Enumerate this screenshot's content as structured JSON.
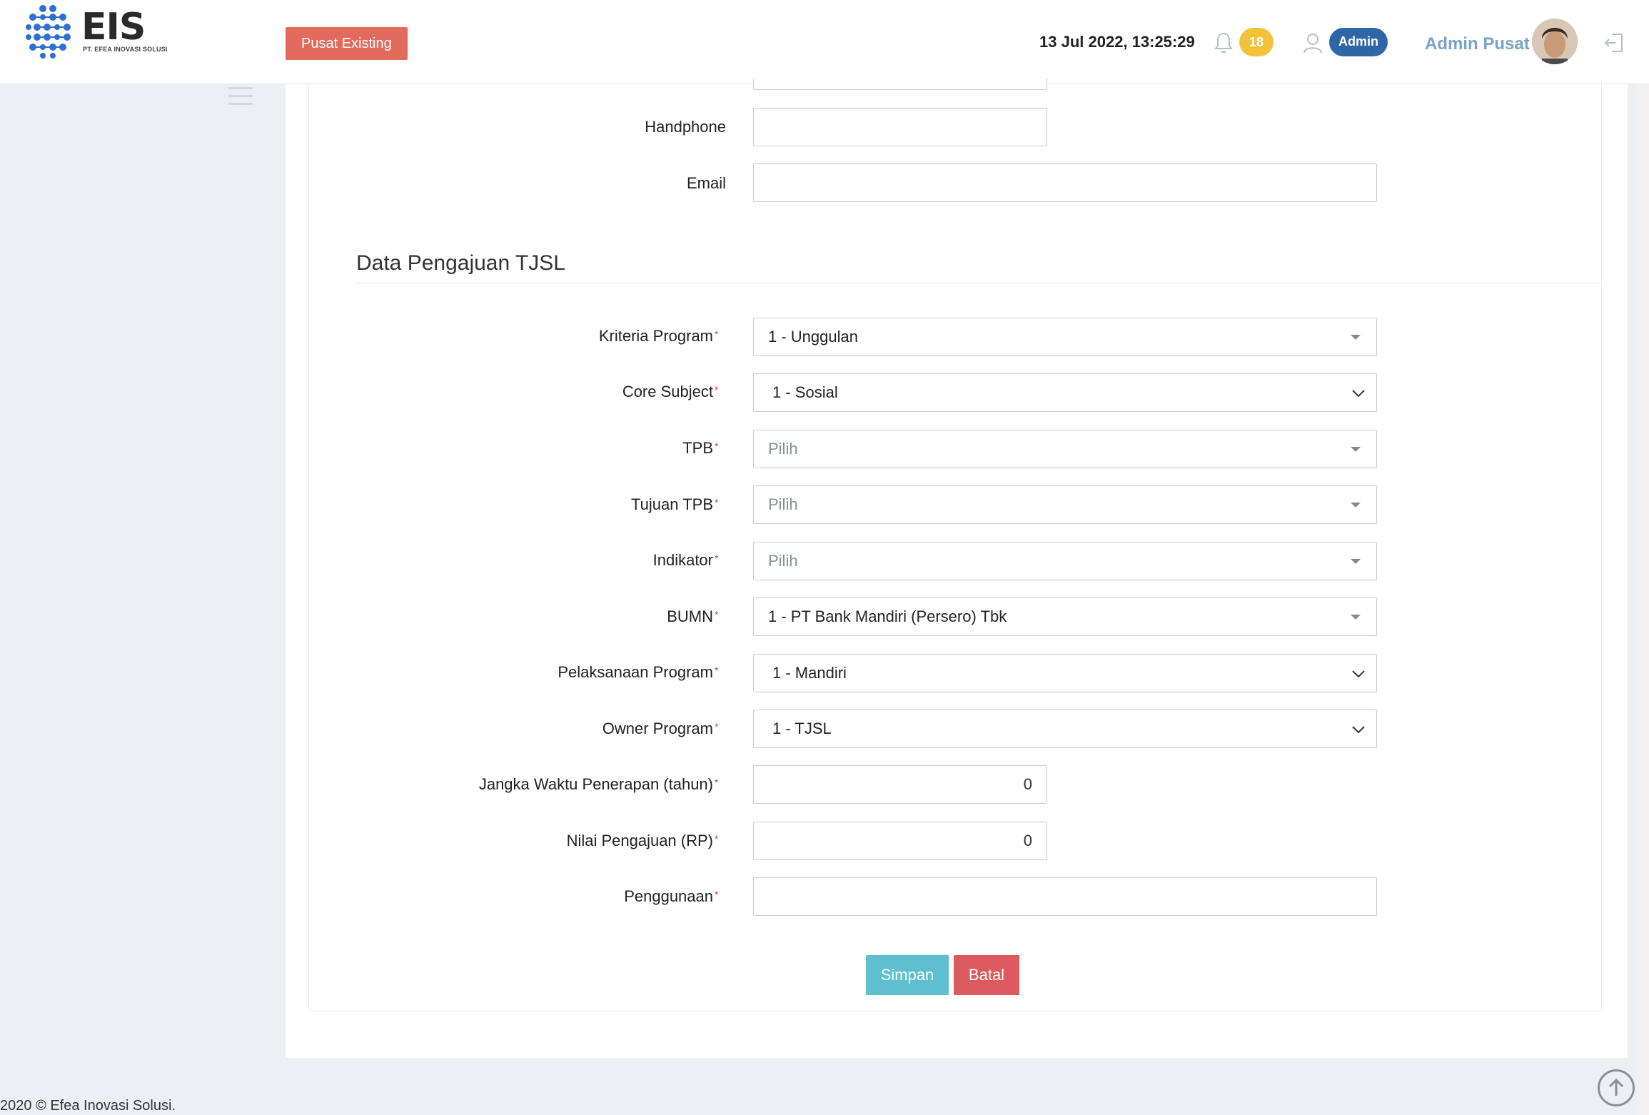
{
  "header": {
    "logo_text": "EIS",
    "logo_subtitle": "PT. EFEA INOVASI SOLUSI",
    "mode_button": "Pusat Existing",
    "datetime": "13 Jul 2022, 13:25:29",
    "notification_count": "18",
    "role": "Admin",
    "user_name": "Admin Pusat"
  },
  "contact": {
    "handphone_label": "Handphone",
    "handphone_value": "",
    "email_label": "Email",
    "email_value": ""
  },
  "section": {
    "title": "Data Pengajuan TJSL"
  },
  "fields": {
    "kriteria_program": {
      "label": "Kriteria Program",
      "value": "1 - Unggulan"
    },
    "core_subject": {
      "label": "Core Subject",
      "value": "1 - Sosial"
    },
    "tpb": {
      "label": "TPB",
      "value": "Pilih"
    },
    "tujuan_tpb": {
      "label": "Tujuan TPB",
      "value": "Pilih"
    },
    "indikator": {
      "label": "Indikator",
      "value": "Pilih"
    },
    "bumn": {
      "label": "BUMN",
      "value": "1 - PT Bank Mandiri (Persero) Tbk"
    },
    "pelaksanaan_program": {
      "label": "Pelaksanaan Program",
      "value": "1 - Mandiri"
    },
    "owner_program": {
      "label": "Owner Program",
      "value": "1 - TJSL"
    },
    "jangka_waktu": {
      "label": "Jangka Waktu Penerapan (tahun)",
      "value": "0"
    },
    "nilai_pengajuan": {
      "label": "Nilai Pengajuan (RP)",
      "value": "0"
    },
    "penggunaan": {
      "label": "Penggunaan",
      "value": ""
    }
  },
  "actions": {
    "save": "Simpan",
    "cancel": "Batal"
  },
  "footer": {
    "copyright": "2020 © Efea Inovasi Solusi."
  },
  "colors": {
    "mode_button": "#e26b5d",
    "notification": "#f3c23a",
    "role": "#2e66a8",
    "save": "#5ec0cf",
    "cancel": "#dc5a5d"
  }
}
